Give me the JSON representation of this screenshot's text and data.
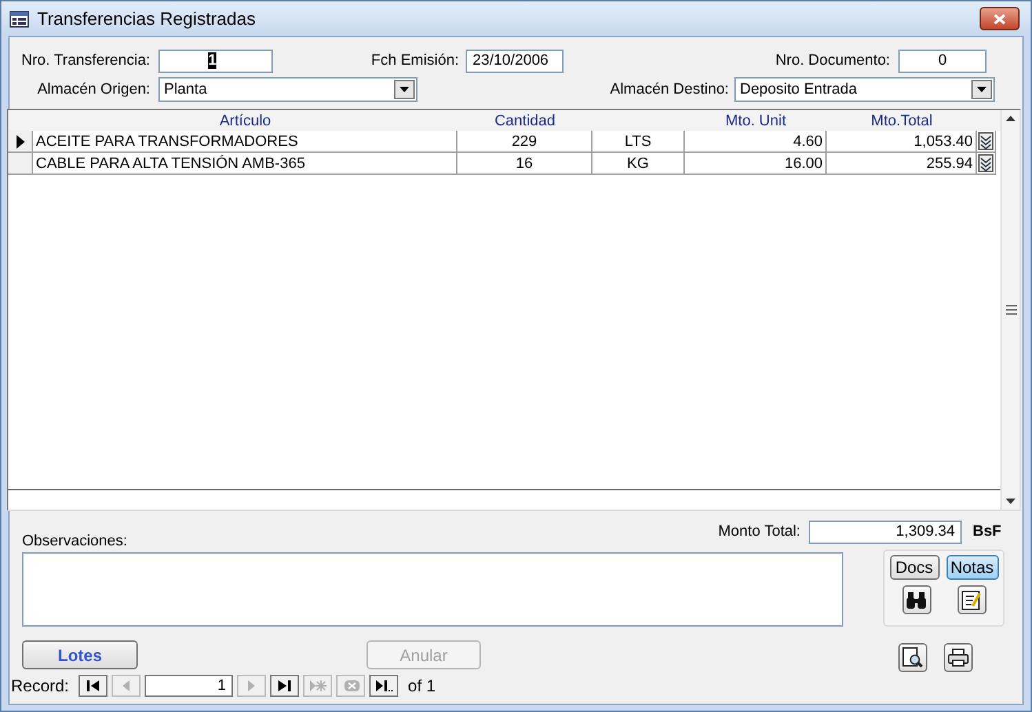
{
  "window": {
    "title": "Transferencias Registradas"
  },
  "header": {
    "transferencia": {
      "label": "Nro. Transferencia:",
      "value": "1"
    },
    "fecha": {
      "label": "Fch Emisión:",
      "value": "23/10/2006"
    },
    "documento": {
      "label": "Nro. Documento:",
      "value": "0"
    },
    "origen": {
      "label": "Almacén Origen:",
      "value": "Planta"
    },
    "destino": {
      "label": "Almacén Destino:",
      "value": "Deposito Entrada"
    }
  },
  "table": {
    "columns": {
      "articulo": "Artículo",
      "cantidad": "Cantidad",
      "mto_unit": "Mto. Unit",
      "mto_total": "Mto.Total"
    },
    "rows": [
      {
        "articulo": "ACEITE PARA TRANSFORMADORES",
        "cantidad": "229",
        "unidad": "LTS",
        "mto_unit": "4.60",
        "mto_total": "1,053.40",
        "selected": true
      },
      {
        "articulo": "CABLE PARA ALTA TENSIÓN AMB-365",
        "cantidad": "16",
        "unidad": "KG",
        "mto_unit": "16.00",
        "mto_total": "255.94",
        "selected": false
      }
    ]
  },
  "monto_total": {
    "label": "Monto Total:",
    "value": "1,309.34",
    "currency": "BsF"
  },
  "observaciones": {
    "label": "Observaciones:"
  },
  "docs_button": {
    "label": "Docs",
    "pressed": false
  },
  "notas_button": {
    "label": "Notas",
    "pressed": true
  },
  "lotes_button": {
    "label": "Lotes",
    "disabled": false
  },
  "anular_button": {
    "label": "Anular",
    "disabled": true
  },
  "record_nav": {
    "label": "Record:",
    "value": "1",
    "of": "of 1",
    "buttons": [
      {
        "kind": "first",
        "disabled": false
      },
      {
        "kind": "prev",
        "disabled": true
      },
      {
        "kind": "next",
        "disabled": true
      },
      {
        "kind": "last",
        "disabled": false
      },
      {
        "kind": "new",
        "disabled": true
      },
      {
        "kind": "delete",
        "disabled": true
      },
      {
        "kind": "last_page",
        "disabled": false
      }
    ]
  }
}
